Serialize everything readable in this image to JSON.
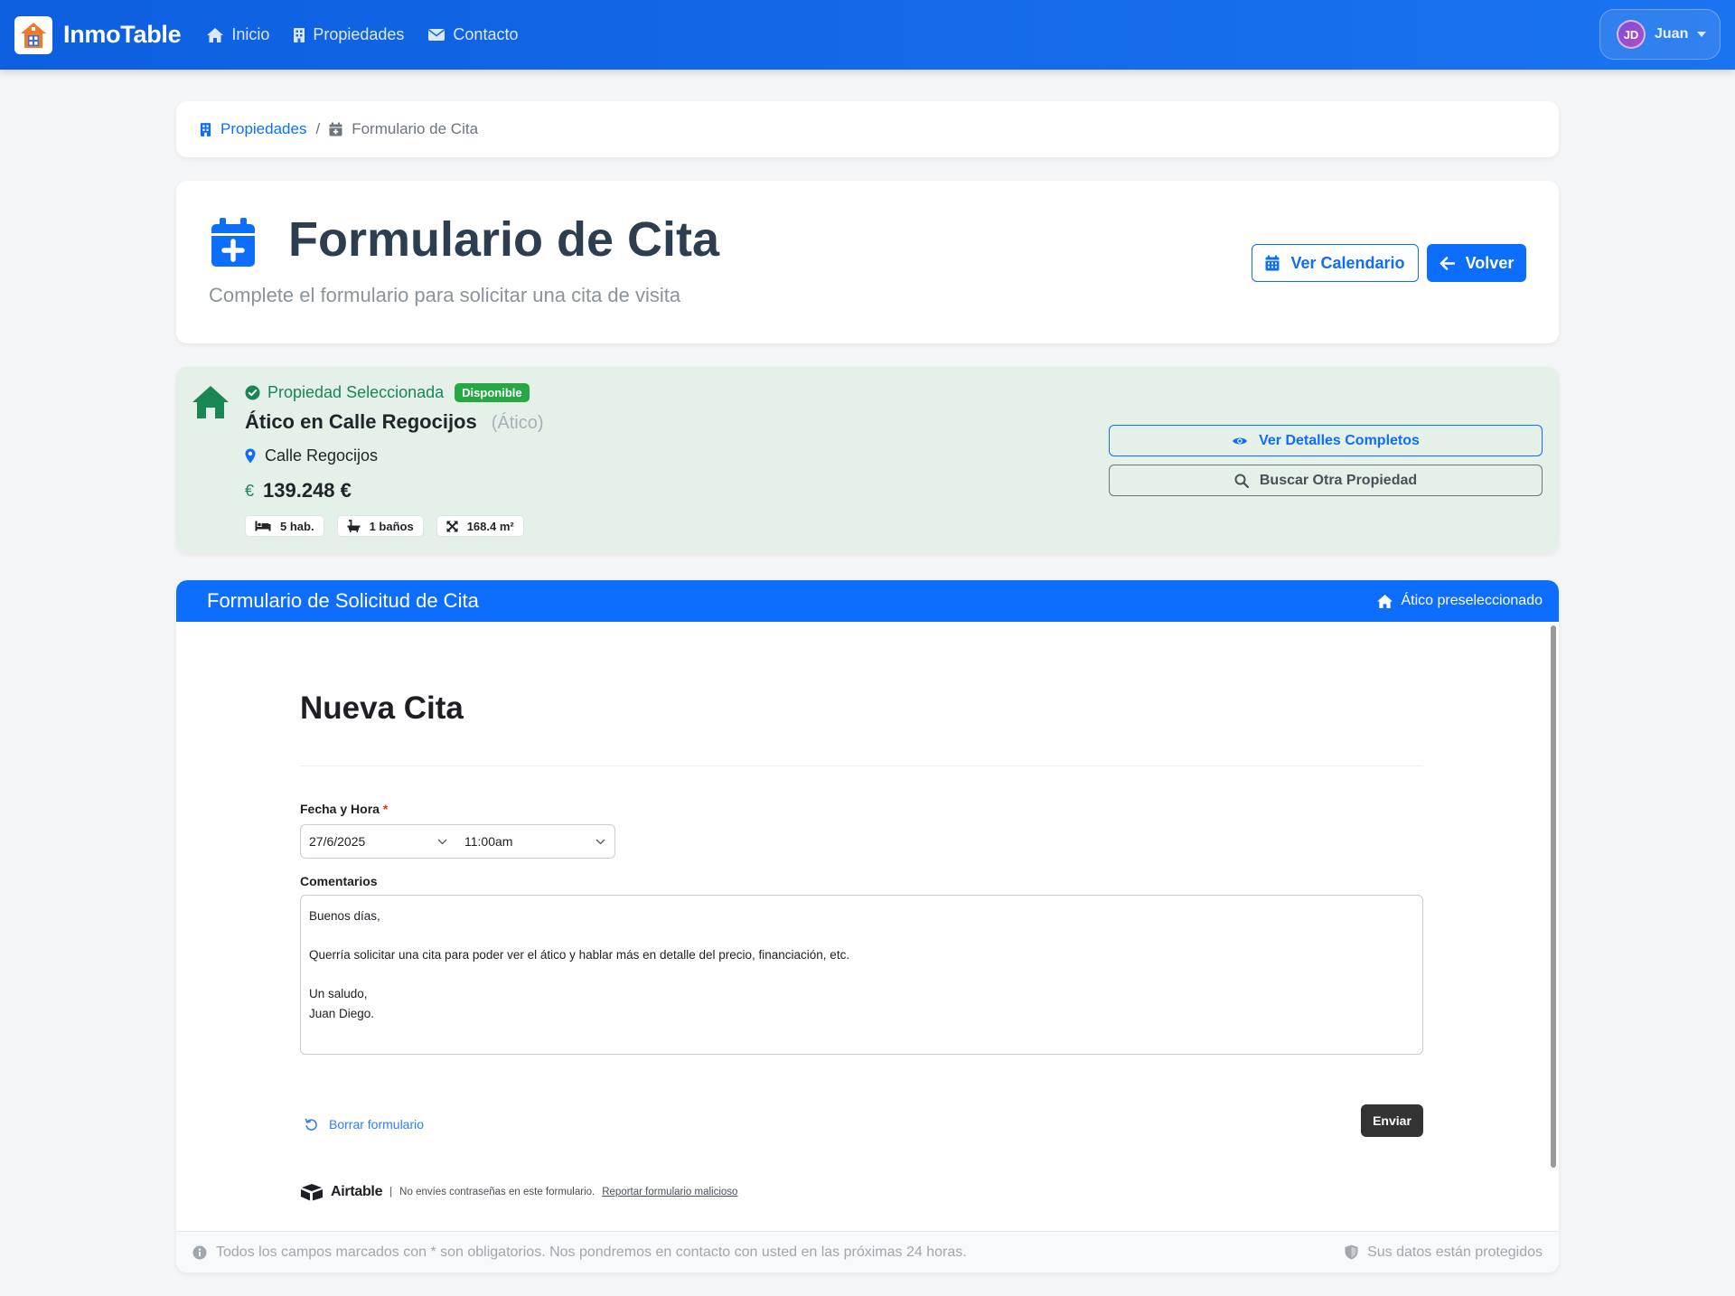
{
  "navbar": {
    "brand": "InmoTable",
    "links": [
      {
        "label": "Inicio",
        "icon": "home-icon"
      },
      {
        "label": "Propiedades",
        "icon": "building-icon"
      },
      {
        "label": "Contacto",
        "icon": "envelope-icon"
      }
    ],
    "user": {
      "initials": "JD",
      "name": "Juan"
    }
  },
  "breadcrumb": {
    "items": [
      {
        "label": "Propiedades",
        "icon": "building-icon"
      },
      {
        "label": "Formulario de Cita",
        "icon": "calendar-plus-icon"
      }
    ],
    "separator": "/"
  },
  "header": {
    "title": "Formulario de Cita",
    "subtitle": "Complete el formulario para solicitar una cita de visita",
    "calendar_button": "Ver Calendario",
    "back_button": "Volver"
  },
  "property": {
    "status_label": "Propiedad Seleccionada",
    "badge": "Disponible",
    "title": "Ático en Calle Regocijos",
    "type": "(Ático)",
    "address": "Calle Regocijos",
    "currency_symbol": "€",
    "price": "139.248 €",
    "features": [
      "5 hab.",
      "1 baños",
      "168.4 m²"
    ],
    "details_button": "Ver Detalles Completos",
    "search_button": "Buscar Otra Propiedad"
  },
  "form": {
    "header_title": "Formulario de Solicitud de Cita",
    "header_note": "Ático preseleccionado",
    "embed_title": "Nueva Cita",
    "datetime_label": "Fecha y Hora",
    "required_mark": "*",
    "date_value": "27/6/2025",
    "time_value": "11:00am",
    "comments_label": "Comentarios",
    "comments_value": "Buenos días,\n\nQuerría solicitar una cita para poder ver el ático y hablar más en detalle del precio, financiación, etc.\n\nUn saludo,\nJuan Diego.",
    "reset_label": "Borrar formulario",
    "submit_label": "Enviar",
    "airtable_name": "Airtable",
    "airtable_separator": "|",
    "airtable_notice": "No envíes contraseñas en este formulario.",
    "report_link": "Reportar formulario malicioso",
    "footer_left": "Todos los campos marcados con * son obligatorios. Nos pondremos en contacto con usted en las próximas 24 horas.",
    "footer_right": "Sus datos están protegidos"
  },
  "colors": {
    "primary": "#0d6efd",
    "success": "#198754",
    "property_bg": "#e4f0e8",
    "title": "#2c3e50"
  }
}
